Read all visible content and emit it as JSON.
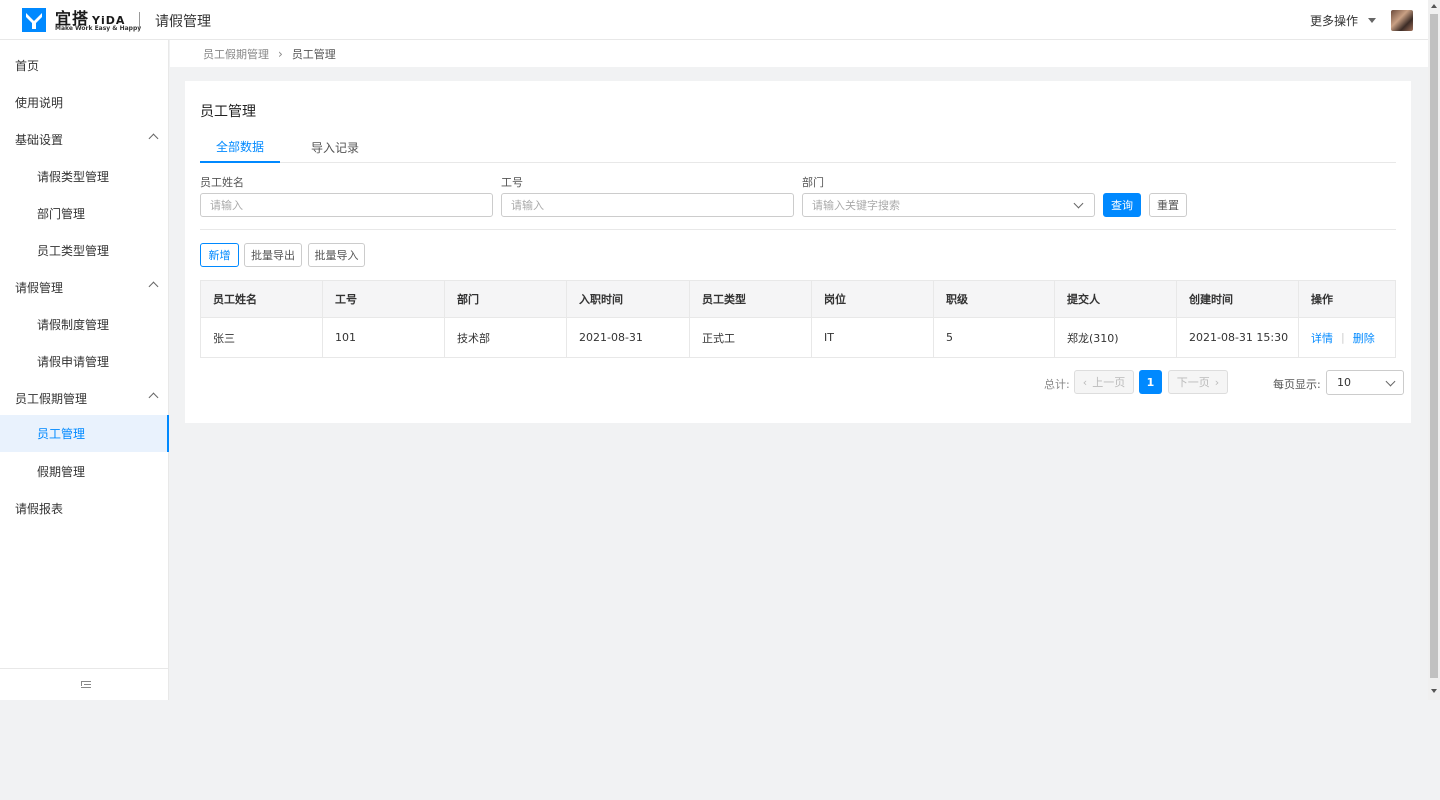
{
  "header": {
    "brand_cn": "宜搭",
    "brand_en": "YiDA",
    "slogan": "Make Work Easy & Happy",
    "app_title": "请假管理",
    "more_actions": "更多操作",
    "logo_color": "#0089ff"
  },
  "sidebar": {
    "items": [
      {
        "label": "首页",
        "level": 1
      },
      {
        "label": "使用说明",
        "level": 1
      },
      {
        "label": "基础设置",
        "level": 1,
        "expanded": true
      },
      {
        "label": "请假类型管理",
        "level": 2
      },
      {
        "label": "部门管理",
        "level": 2
      },
      {
        "label": "员工类型管理",
        "level": 2
      },
      {
        "label": "请假管理",
        "level": 1,
        "expanded": true
      },
      {
        "label": "请假制度管理",
        "level": 2
      },
      {
        "label": "请假申请管理",
        "level": 2
      },
      {
        "label": "员工假期管理",
        "level": 1,
        "expanded": true
      },
      {
        "label": "员工管理",
        "level": 2,
        "active": true
      },
      {
        "label": "假期管理",
        "level": 2
      },
      {
        "label": "请假报表",
        "level": 1
      }
    ],
    "collapse_icon": "collapse-menu-icon"
  },
  "breadcrumb": {
    "parent": "员工假期管理",
    "current": "员工管理"
  },
  "page": {
    "title": "员工管理",
    "tabs": [
      "全部数据",
      "导入记录"
    ],
    "active_tab": 0
  },
  "filters": {
    "name_label": "员工姓名",
    "name_placeholder": "请输入",
    "id_label": "工号",
    "id_placeholder": "请输入",
    "dept_label": "部门",
    "dept_placeholder": "请输入关键字搜索",
    "query_btn": "查询",
    "reset_btn": "重置"
  },
  "actions": {
    "add": "新增",
    "export": "批量导出",
    "import": "批量导入"
  },
  "table": {
    "columns": [
      "员工姓名",
      "工号",
      "部门",
      "入职时间",
      "员工类型",
      "岗位",
      "职级",
      "提交人",
      "创建时间",
      "操作"
    ],
    "rows": [
      [
        "张三",
        "101",
        "技术部",
        "2021-08-31",
        "正式工",
        "IT",
        "5",
        "郑龙(310)",
        "2021-08-31 15:30"
      ]
    ],
    "op_detail": "详情",
    "op_delete": "删除",
    "op_separator": "|"
  },
  "pagination": {
    "total_label": "总计: 1",
    "prev": "上一页",
    "next": "下一页",
    "current_page": "1",
    "per_page_label": "每页显示:",
    "per_page_value": "10"
  },
  "colors": {
    "accent": "#0089ff",
    "background": "#f1f2f3",
    "active_bg": "#e9f2fd"
  }
}
